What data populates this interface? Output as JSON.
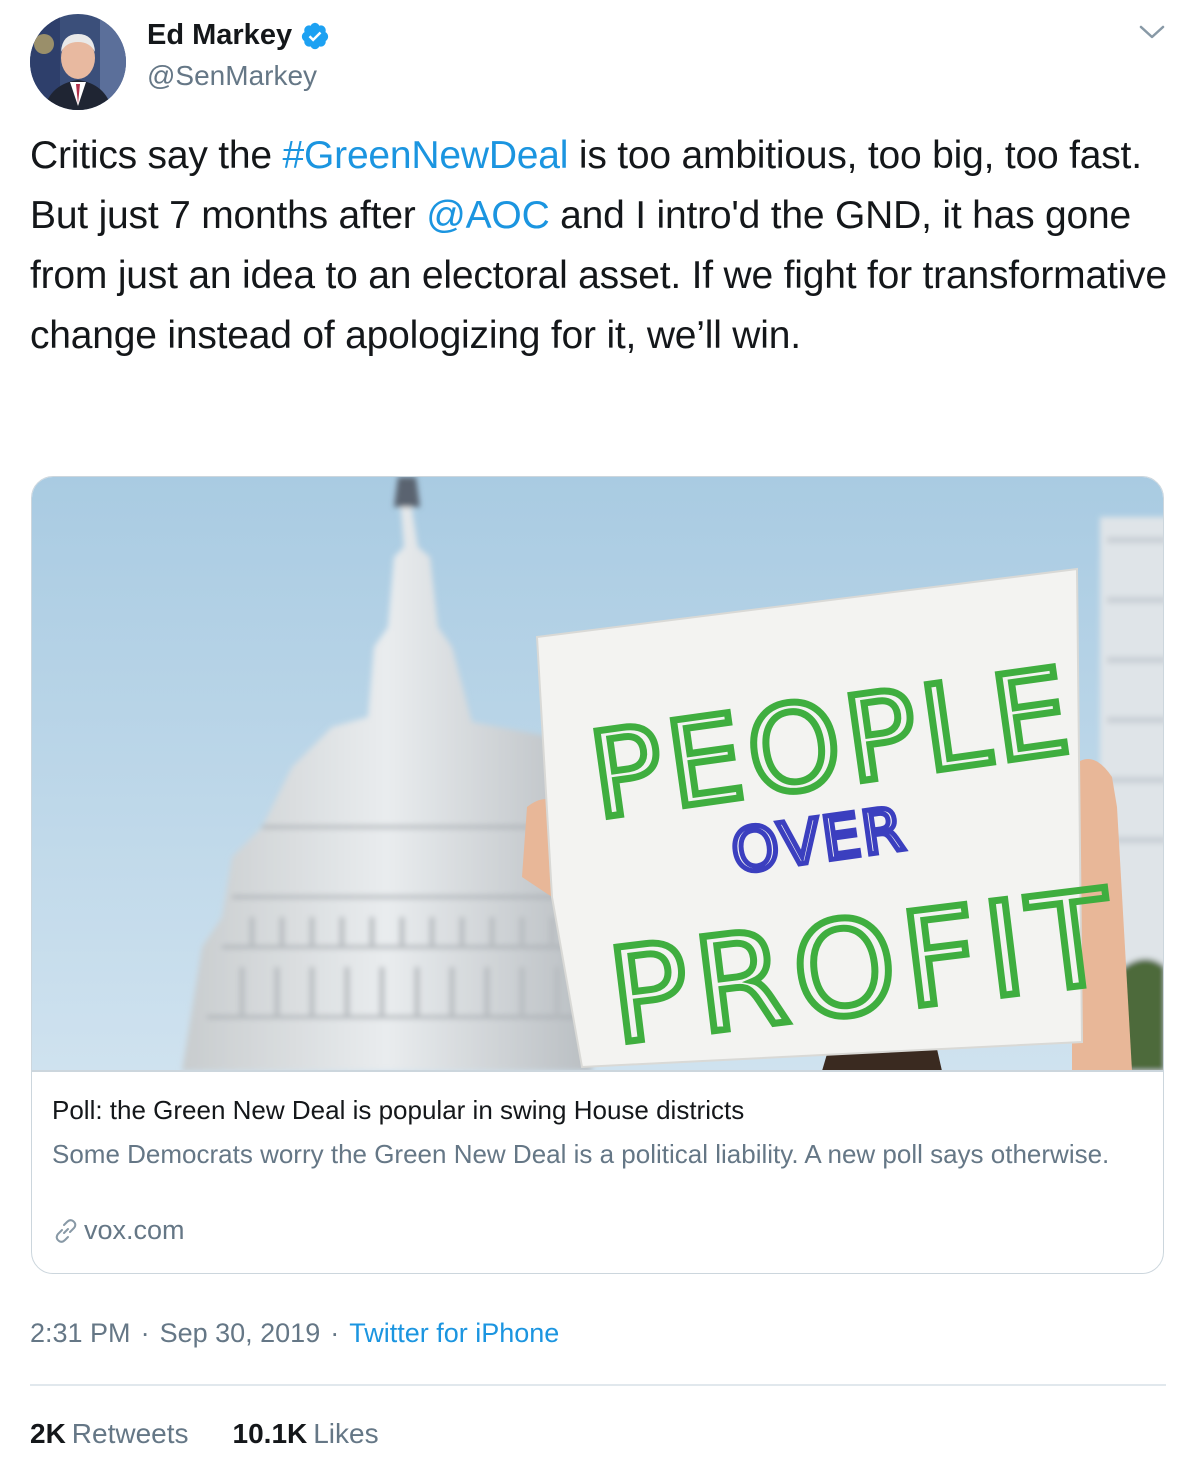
{
  "author": {
    "name": "Ed Markey",
    "handle": "@SenMarkey",
    "verified": true
  },
  "tweet": {
    "text_1": "Critics say the ",
    "hashtag": "#GreenNewDeal",
    "text_2": " is too ambitious, too big, too fast. But just 7 months after ",
    "mention": "@AOC",
    "text_3": " and I intro'd the GND, it has gone from just an idea to an electoral asset. If we fight for transformative change instead of apologizing for it, we’ll win."
  },
  "card": {
    "sign": {
      "line1": "PEOPLE",
      "line2": "OVER",
      "line3": "PROFIT"
    },
    "title": "Poll: the Green New Deal is popular in swing House districts",
    "description": "Some Democrats worry the Green New Deal is a political liability. A new poll says otherwise.",
    "domain": "vox.com"
  },
  "meta": {
    "time": "2:31 PM",
    "date": "Sep 30, 2019",
    "separator": "·",
    "source": "Twitter for iPhone"
  },
  "stats": {
    "retweets_count": "2K",
    "retweets_label": "Retweets",
    "likes_count": "10.1K",
    "likes_label": "Likes"
  },
  "colors": {
    "link": "#1b95e0",
    "secondary_text": "#657786",
    "primary_text": "#14171a",
    "border": "#ccd6dd",
    "verified_badge": "#1da1f2",
    "sign_green": "#3fae3f",
    "sign_blue": "#3b3fbf"
  },
  "icons": {
    "verified": "verified-badge-icon",
    "caret": "chevron-down-icon",
    "link": "link-icon"
  }
}
